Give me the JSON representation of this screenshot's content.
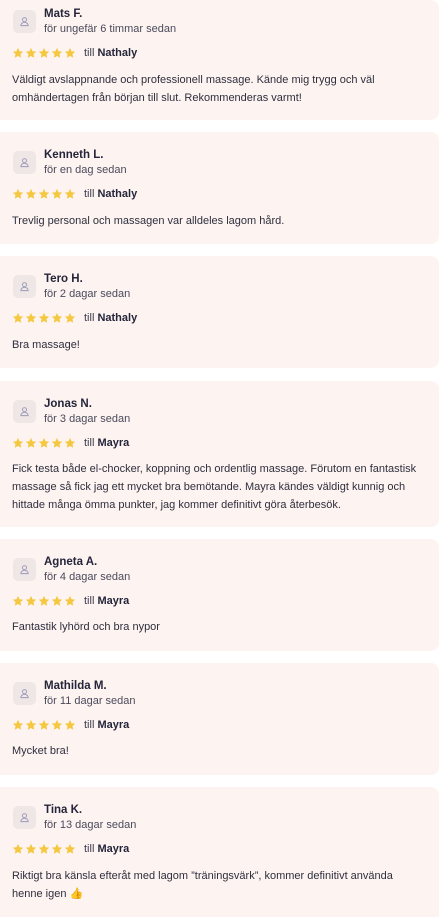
{
  "reviews": [
    {
      "name": "Mats F.",
      "time": "för ungefär 6 timmar sedan",
      "to_prefix": "till",
      "therapist": "Nathaly",
      "rating": 5,
      "text": "Väldigt avslappnande och professionell massage. Kände mig trygg och väl omhändertagen från början till slut. Rekommenderas varmt!"
    },
    {
      "name": "Kenneth L.",
      "time": "för en dag sedan",
      "to_prefix": "till",
      "therapist": "Nathaly",
      "rating": 5,
      "text": "Trevlig personal och massagen var alldeles lagom hård."
    },
    {
      "name": "Tero H.",
      "time": "för 2 dagar sedan",
      "to_prefix": "till",
      "therapist": "Nathaly",
      "rating": 5,
      "text": "Bra massage!"
    },
    {
      "name": "Jonas N.",
      "time": "för 3 dagar sedan",
      "to_prefix": "till",
      "therapist": "Mayra",
      "rating": 5,
      "text": "Fick testa både el-chocker, koppning och ordentlig massage. Förutom en fantastisk massage så fick jag ett mycket bra bemötande. Mayra kändes väldigt kunnig och hittade många ömma punkter, jag kommer definitivt göra återbesök."
    },
    {
      "name": "Agneta A.",
      "time": "för 4 dagar sedan",
      "to_prefix": "till",
      "therapist": "Mayra",
      "rating": 5,
      "text": "Fantastik lyhörd och bra nypor"
    },
    {
      "name": "Mathilda M.",
      "time": "för 11 dagar sedan",
      "to_prefix": "till",
      "therapist": "Mayra",
      "rating": 5,
      "text": "Mycket bra!"
    },
    {
      "name": "Tina K.",
      "time": "för 13 dagar sedan",
      "to_prefix": "till",
      "therapist": "Mayra",
      "rating": 5,
      "text": "Riktigt bra känsla efteråt med lagom ”träningsvärk”, kommer definitivt använda henne igen 👍"
    }
  ],
  "colors": {
    "star": "#f5c842",
    "card": "#fdf4f2",
    "avatar_bg": "#efe6e6"
  },
  "icons": {
    "avatar": "user-icon",
    "star": "star-icon"
  }
}
